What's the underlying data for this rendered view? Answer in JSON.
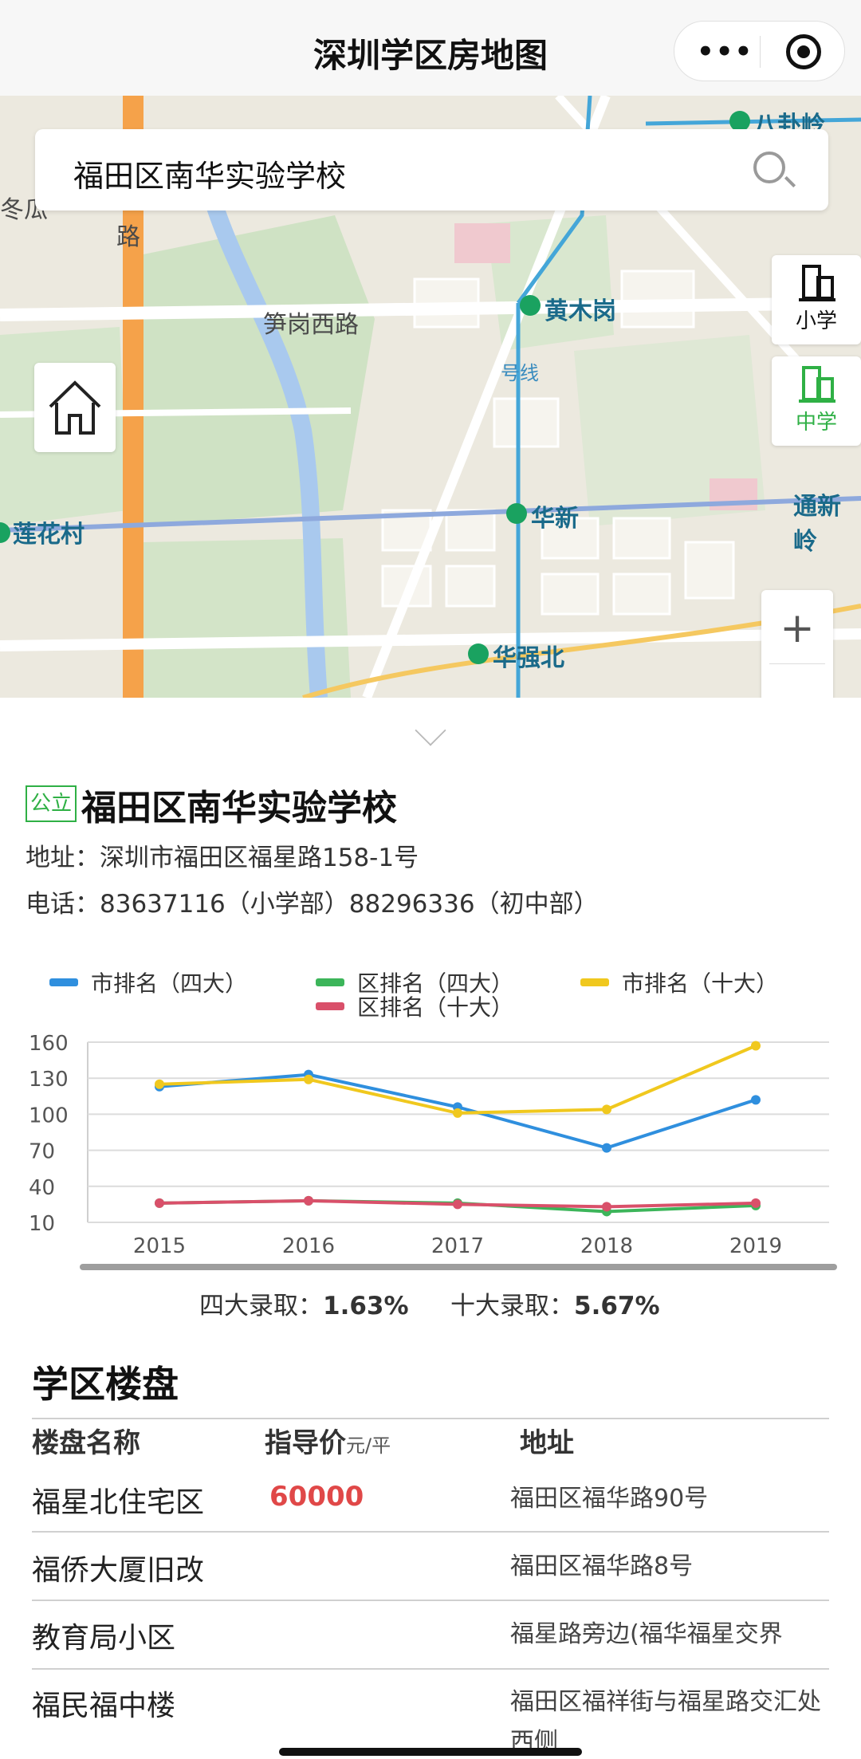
{
  "header": {
    "title": "深圳学区房地图",
    "more_icon": "more-dots-icon",
    "close_icon": "target-icon"
  },
  "map": {
    "search": {
      "value": "福田区南华实验学校"
    },
    "labels": {
      "road1": "笋岗西路",
      "road2": "路",
      "area1": "冬瓜",
      "line": "号线"
    },
    "stations": {
      "s1": "黄木岗",
      "s2": "莲花村",
      "s3": "华新",
      "s4": "华强北",
      "s5": "通新岭",
      "s6": "八卦岭"
    },
    "buttons": {
      "primary_school": "小学",
      "middle_school": "中学",
      "zoom_in": "+",
      "zoom_out": "−"
    },
    "colors": {
      "middle_school": "#2fb045"
    }
  },
  "school": {
    "badge": "公立",
    "name": "福田区南华实验学校",
    "address": "地址：深圳市福田区福星路158-1号",
    "phone": "电话：83637116（小学部）88296336（初中部）"
  },
  "chart_data": {
    "type": "line",
    "categories": [
      "2015",
      "2016",
      "2017",
      "2018",
      "2019"
    ],
    "ylim": [
      10,
      160
    ],
    "yticks": [
      160,
      130,
      100,
      70,
      40,
      10
    ],
    "grid": true,
    "legend_position": "top",
    "series": [
      {
        "name": "市排名（四大）",
        "color": "#2f8fde",
        "values": [
          123,
          133,
          106,
          72,
          112
        ]
      },
      {
        "name": "区排名（四大）",
        "color": "#3cb55a",
        "values": [
          26,
          28,
          26,
          19,
          24
        ]
      },
      {
        "name": "市排名（十大）",
        "color": "#f0c81e",
        "values": [
          125,
          129,
          101,
          104,
          157
        ]
      },
      {
        "name": "区排名（十大）",
        "color": "#d9506a",
        "values": [
          26,
          28,
          25,
          23,
          26
        ]
      }
    ]
  },
  "admission": {
    "four_label": "四大录取：",
    "four_value": "1.63%",
    "ten_label": "十大录取：",
    "ten_value": "5.67%"
  },
  "estates": {
    "title": "学区楼盘",
    "headers": {
      "name": "楼盘名称",
      "price": "指导价",
      "price_unit": "元/平",
      "address": "地址"
    },
    "rows": [
      {
        "name": "福星北住宅区",
        "price": "60000",
        "address": "福田区福华路90号"
      },
      {
        "name": "福侨大厦旧改",
        "price": "",
        "address": "福田区福华路8号"
      },
      {
        "name": "教育局小区",
        "price": "",
        "address": "福星路旁边(福华福星交界"
      },
      {
        "name": "福民福中楼",
        "price": "",
        "address": "福田区福祥街与福星路交汇处西侧"
      }
    ]
  }
}
